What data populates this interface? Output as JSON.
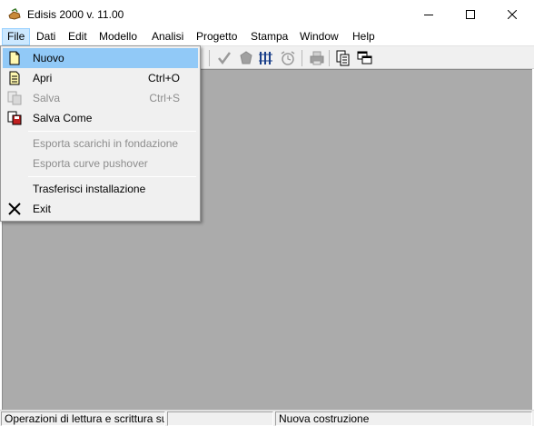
{
  "window": {
    "title": "Edisis 2000 v. 11.00",
    "app_icon": "edisis-app-icon",
    "controls": [
      "minimize-icon",
      "maximize-icon",
      "close-icon"
    ]
  },
  "menubar": {
    "items": [
      {
        "label": "File",
        "active": true
      },
      {
        "label": "Dati"
      },
      {
        "label": "Edit"
      },
      {
        "label": "Modello"
      },
      {
        "label": "Analisi"
      },
      {
        "label": "Progetto"
      },
      {
        "label": "Stampa"
      },
      {
        "label": "Window"
      },
      {
        "label": "Help"
      }
    ]
  },
  "file_menu": {
    "items": [
      {
        "label": "Nuovo",
        "shortcut": "",
        "enabled": true,
        "highlighted": true,
        "icon": "new-document-icon"
      },
      {
        "label": "Apri",
        "shortcut": "Ctrl+O",
        "enabled": true,
        "icon": "open-document-icon"
      },
      {
        "label": "Salva",
        "shortcut": "Ctrl+S",
        "enabled": false,
        "icon": "save-icon"
      },
      {
        "label": "Salva Come",
        "shortcut": "",
        "enabled": true,
        "icon": "save-as-icon"
      },
      {
        "label": "Esporta scarichi in fondazione",
        "shortcut": "",
        "enabled": false
      },
      {
        "label": "Esporta curve pushover",
        "shortcut": "",
        "enabled": false
      },
      {
        "label": "Trasferisci installazione",
        "shortcut": "",
        "enabled": true
      },
      {
        "label": "Exit",
        "shortcut": "",
        "enabled": true,
        "icon": "exit-x-icon"
      }
    ]
  },
  "toolbar": {
    "icons": [
      "check-icon",
      "pentagon-icon",
      "column-bars-icon",
      "alarm-clock-icon",
      "printer-icon",
      "copy-pages-icon",
      "cascade-windows-icon"
    ]
  },
  "statusbar": {
    "panels": [
      "Operazioni di lettura e scrittura su",
      "",
      "Nuova costruzione",
      ""
    ]
  },
  "colors": {
    "client_background": "#ababab",
    "menu_highlight": "#91c9f7",
    "menubar_active": "#cce8ff"
  }
}
